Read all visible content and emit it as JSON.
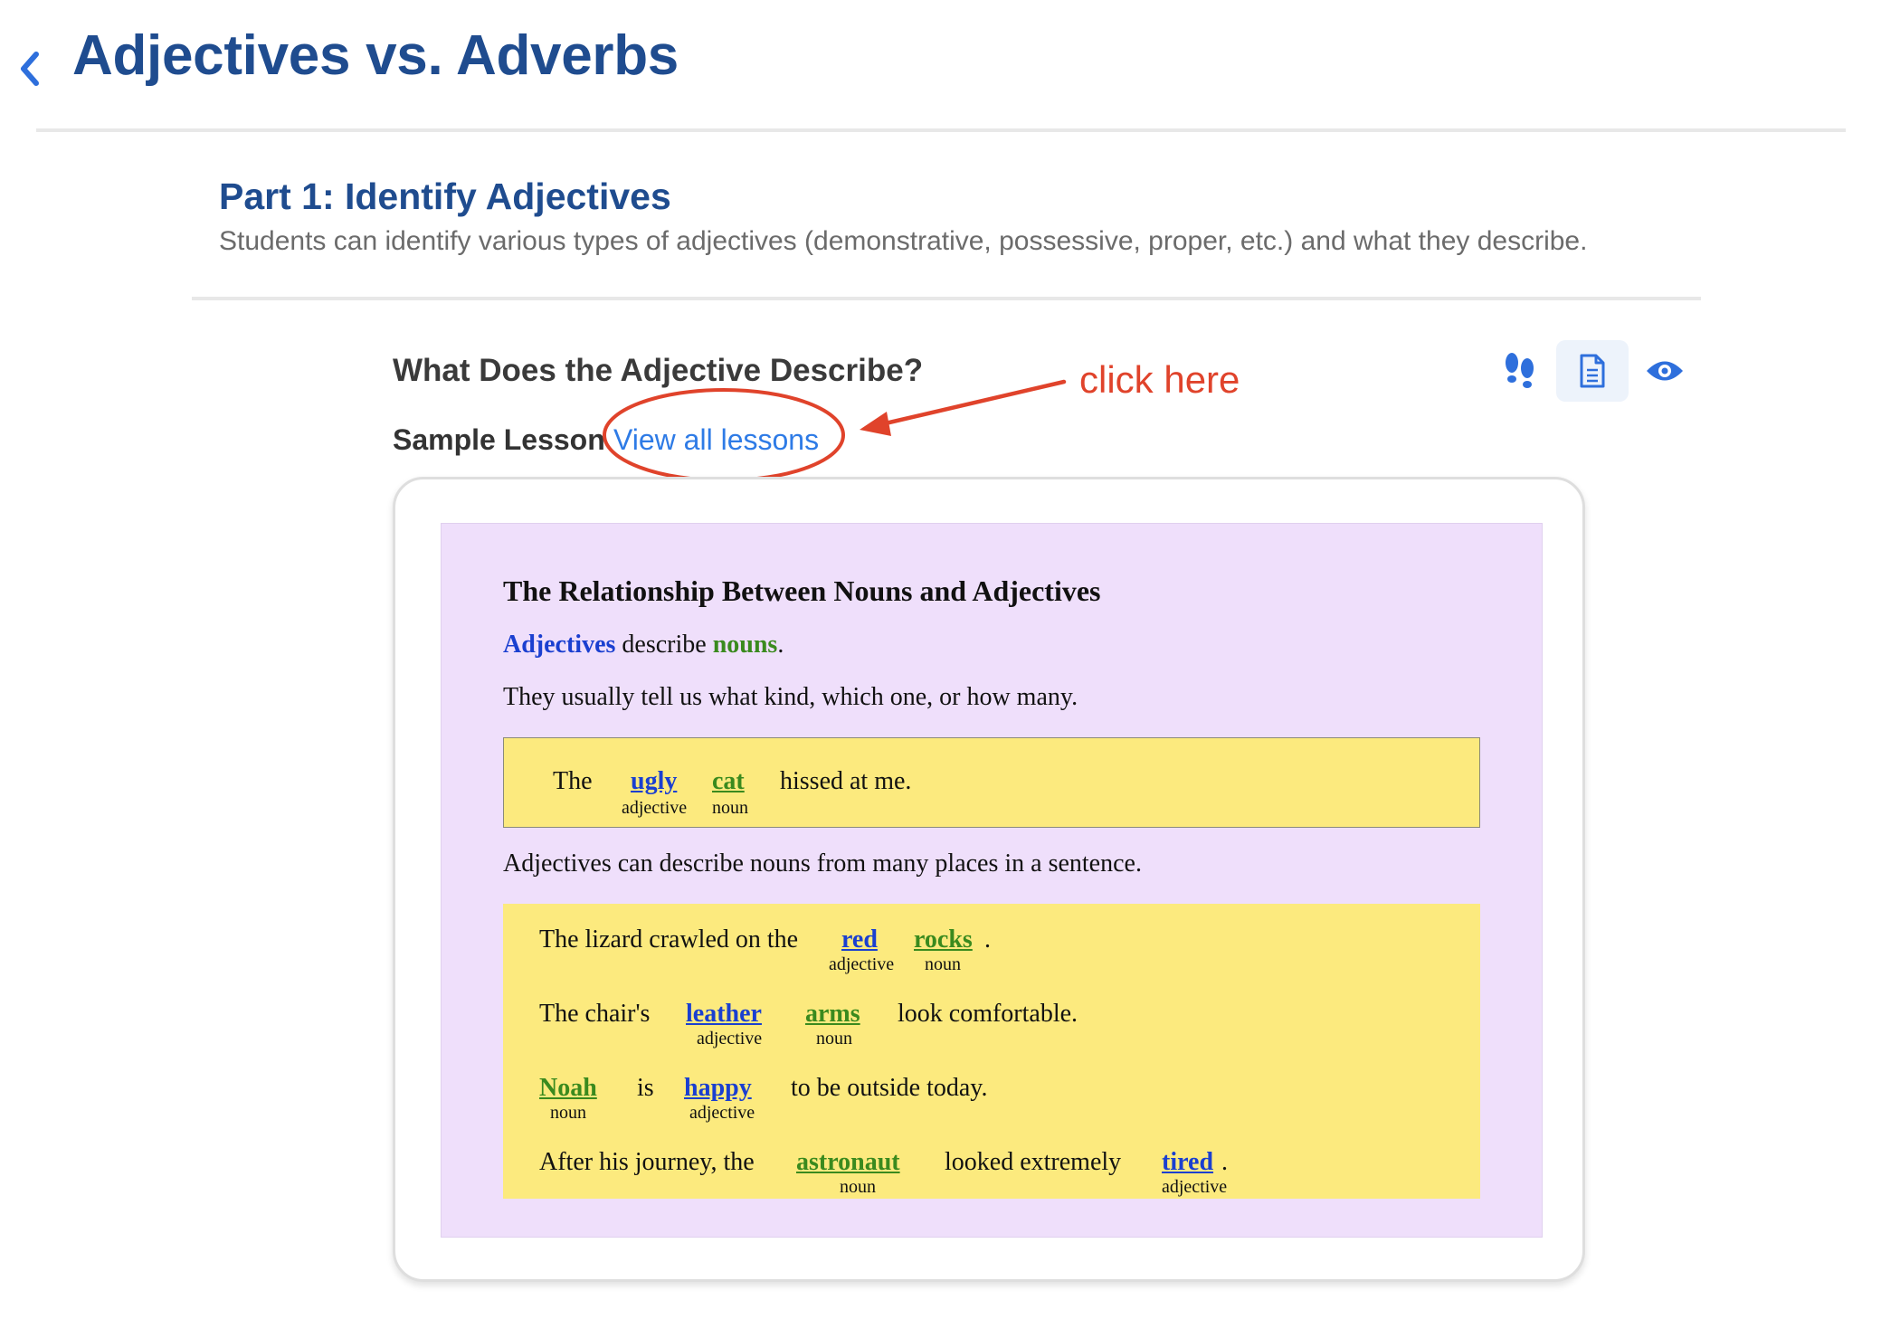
{
  "header": {
    "title": "Adjectives vs. Adverbs"
  },
  "part": {
    "title": "Part 1: Identify Adjectives",
    "description": "Students can identify various types of adjectives (demonstrative, possessive, proper, etc.) and what they describe."
  },
  "lesson": {
    "heading": "What Does the Adjective Describe?",
    "sample_label": "Sample Lesson",
    "view_all_link": "View all lessons",
    "actions": [
      "steps-icon",
      "document-icon",
      "eye-icon"
    ]
  },
  "annotation": {
    "text": "click here",
    "color": "#e0432b"
  },
  "panel": {
    "title": "The Relationship Between Nouns and Adjectives",
    "intro": {
      "adjectives": "Adjectives",
      "describe": " describe ",
      "nouns": "nouns",
      "period": "."
    },
    "usage": "They usually tell us what kind, which one, or how many.",
    "example": {
      "the": "The",
      "adj": "ugly",
      "adj_label": "adjective",
      "noun": "cat",
      "noun_label": "noun",
      "rest": "hissed at me."
    },
    "places": "Adjectives can describe nouns from many places in a sentence.",
    "sentences": {
      "s1": {
        "start": "The lizard crawled on the",
        "adj": "red",
        "adj_label": "adjective",
        "noun": "rocks",
        "noun_label": "noun",
        "end": "."
      },
      "s2": {
        "start": "The chair's",
        "adj": "leather",
        "adj_label": "adjective",
        "noun": "arms",
        "noun_label": "noun",
        "end": "look comfortable."
      },
      "s3": {
        "noun": "Noah",
        "noun_label": "noun",
        "mid": "is",
        "adj": "happy",
        "adj_label": "adjective",
        "end": "to be outside today."
      },
      "s4": {
        "start": "After his journey, the",
        "noun": "astronaut",
        "noun_label": "noun",
        "mid": "looked extremely",
        "adj": "tired",
        "adj_label": "adjective",
        "end": "."
      }
    }
  },
  "colors": {
    "title_blue": "#1f4c8f",
    "link_blue": "#2e7be6",
    "panel_purple": "#efdffb",
    "example_yellow": "#fcea7e",
    "adjective_blue": "#1a3fd0",
    "noun_green": "#3a8a1e"
  }
}
